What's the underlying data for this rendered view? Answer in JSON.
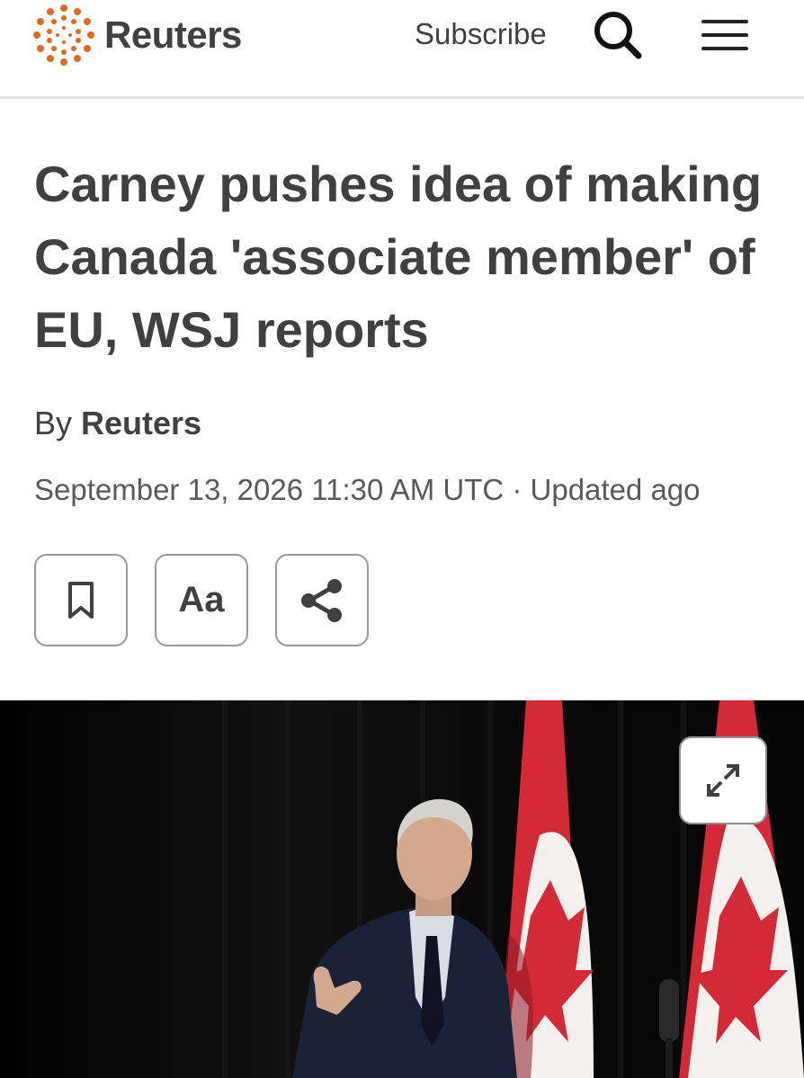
{
  "header": {
    "logo_text": "Reuters",
    "logo_icon": "reuters-dot-ring-logo",
    "brand_color": "#e06a1f",
    "subscribe_label": "Subscribe",
    "search_icon": "search-icon",
    "menu_icon": "hamburger-menu-icon"
  },
  "article": {
    "headline": "Carney pushes idea of making Canada 'associate member' of EU, WSJ reports",
    "byline_prefix": "By",
    "byline_author": "Reuters",
    "dateline": "September 13, 2026 11:30 AM UTC · Updated ago"
  },
  "actions": {
    "bookmark_icon": "bookmark-icon",
    "font_label": "Aa",
    "share_icon": "share-icon"
  },
  "hero": {
    "expand_icon": "expand-icon",
    "flag_color": "#d42a35"
  }
}
